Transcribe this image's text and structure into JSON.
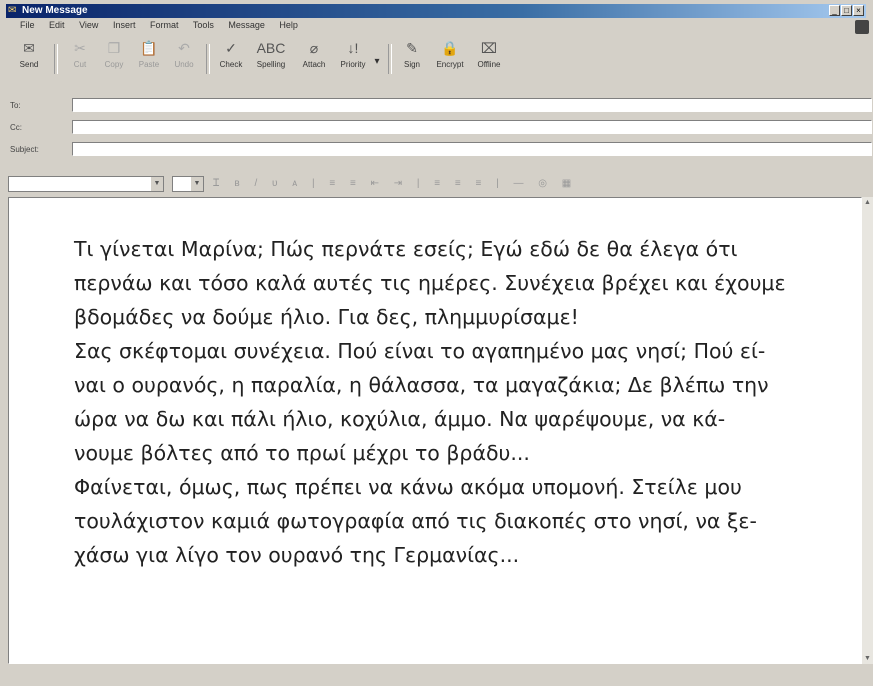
{
  "window": {
    "title": "New Message"
  },
  "menu": [
    "File",
    "Edit",
    "View",
    "Insert",
    "Format",
    "Tools",
    "Message",
    "Help"
  ],
  "toolbar": {
    "buttons": [
      {
        "label": "Send",
        "icon": "send-icon",
        "enabled": true
      },
      {
        "label": "Cut",
        "icon": "cut-icon",
        "enabled": false
      },
      {
        "label": "Copy",
        "icon": "copy-icon",
        "enabled": false
      },
      {
        "label": "Paste",
        "icon": "paste-icon",
        "enabled": false
      },
      {
        "label": "Undo",
        "icon": "undo-icon",
        "enabled": false
      },
      {
        "label": "Check",
        "icon": "check-names-icon",
        "enabled": true
      },
      {
        "label": "Spelling",
        "icon": "spelling-icon",
        "enabled": true
      },
      {
        "label": "Attach",
        "icon": "paperclip-icon",
        "enabled": true
      },
      {
        "label": "Priority",
        "icon": "priority-icon",
        "enabled": true
      },
      {
        "label": "Sign",
        "icon": "sign-icon",
        "enabled": true
      },
      {
        "label": "Encrypt",
        "icon": "encrypt-icon",
        "enabled": true
      },
      {
        "label": "Offline",
        "icon": "offline-icon",
        "enabled": true
      }
    ]
  },
  "header": {
    "to_label": "To:",
    "cc_label": "Cc:",
    "subject_label": "Subject:",
    "to_value": "",
    "cc_value": "",
    "subject_value": ""
  },
  "message": {
    "lines": [
      "Τι γίνεται Μαρίνα; Πώς περνάτε εσείς; Εγώ εδώ δε θα έλεγα ότι",
      "περνάω και τόσο καλά αυτές τις ημέρες. Συνέχεια βρέχει και έχουμε",
      "βδομάδες να δούμε ήλιο. Για δες, πλημμυρίσαμε!",
      "Σας σκέφτομαι συνέχεια. Πού είναι το αγαπημένο μας νησί; Πού εί-",
      "ναι ο ουρανός, η παραλία, η θάλασσα, τα μαγαζάκια; Δε βλέπω την",
      "ώρα να δω και πάλι ήλιο, κοχύλια, άμμο. Να ψαρέψουμε, να κά-",
      "νουμε βόλτες από το πρωί μέχρι το βράδυ...",
      "Φαίνεται, όμως, πως πρέπει να κάνω ακόμα υπομονή. Στείλε μου",
      "τουλάχιστον καμιά φωτογραφία από τις διακοπές στο νησί, να ξε-",
      "χάσω για λίγο τον ουρανό της Γερμανίας..."
    ]
  }
}
